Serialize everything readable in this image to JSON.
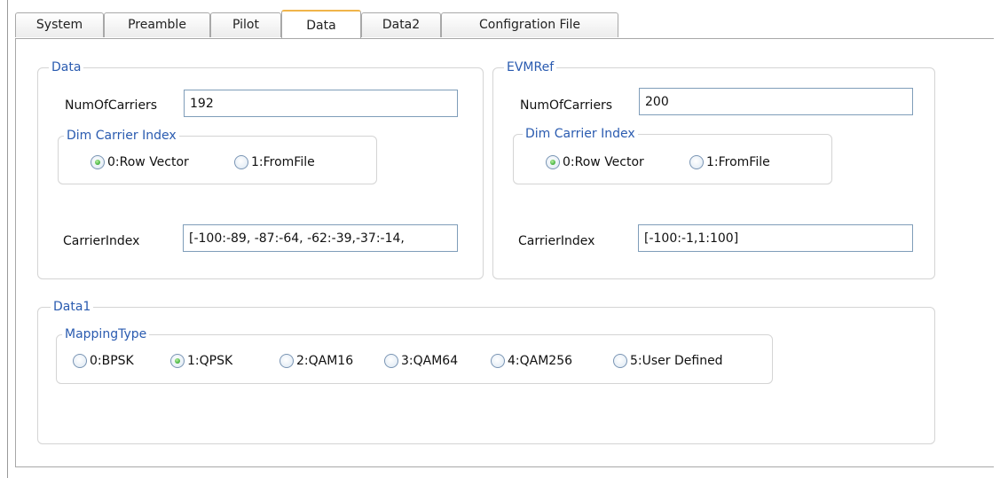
{
  "tabs": [
    "System",
    "Preamble",
    "Pilot",
    "Data",
    "Data2",
    "Configration File"
  ],
  "active_tab": "Data",
  "data_group": {
    "title": "Data",
    "num_carriers_label": "NumOfCarriers",
    "num_carriers_value": "192",
    "dim_group": {
      "title": "Dim Carrier Index",
      "options": [
        "0:Row Vector",
        "1:FromFile"
      ],
      "selected": "0:Row Vector"
    },
    "carrier_index_label": "CarrierIndex",
    "carrier_index_value": "[-100:-89, -87:-64, -62:-39,-37:-14,"
  },
  "evmref_group": {
    "title": "EVMRef",
    "num_carriers_label": "NumOfCarriers",
    "num_carriers_value": "200",
    "dim_group": {
      "title": "Dim Carrier Index",
      "options": [
        "0:Row Vector",
        "1:FromFile"
      ],
      "selected": "0:Row Vector"
    },
    "carrier_index_label": "CarrierIndex",
    "carrier_index_value": "[-100:-1,1:100]"
  },
  "data1_group": {
    "title": "Data1",
    "mapping_group": {
      "title": "MappingType",
      "options": [
        "0:BPSK",
        "1:QPSK",
        "2:QAM16",
        "3:QAM64",
        "4:QAM256",
        "5:User Defined"
      ],
      "selected": "1:QPSK"
    }
  },
  "colors": {
    "legend_text": "#2a5bb0",
    "active_tab_accent": "#f0b44a",
    "radio_checked": "#4fb94a"
  }
}
